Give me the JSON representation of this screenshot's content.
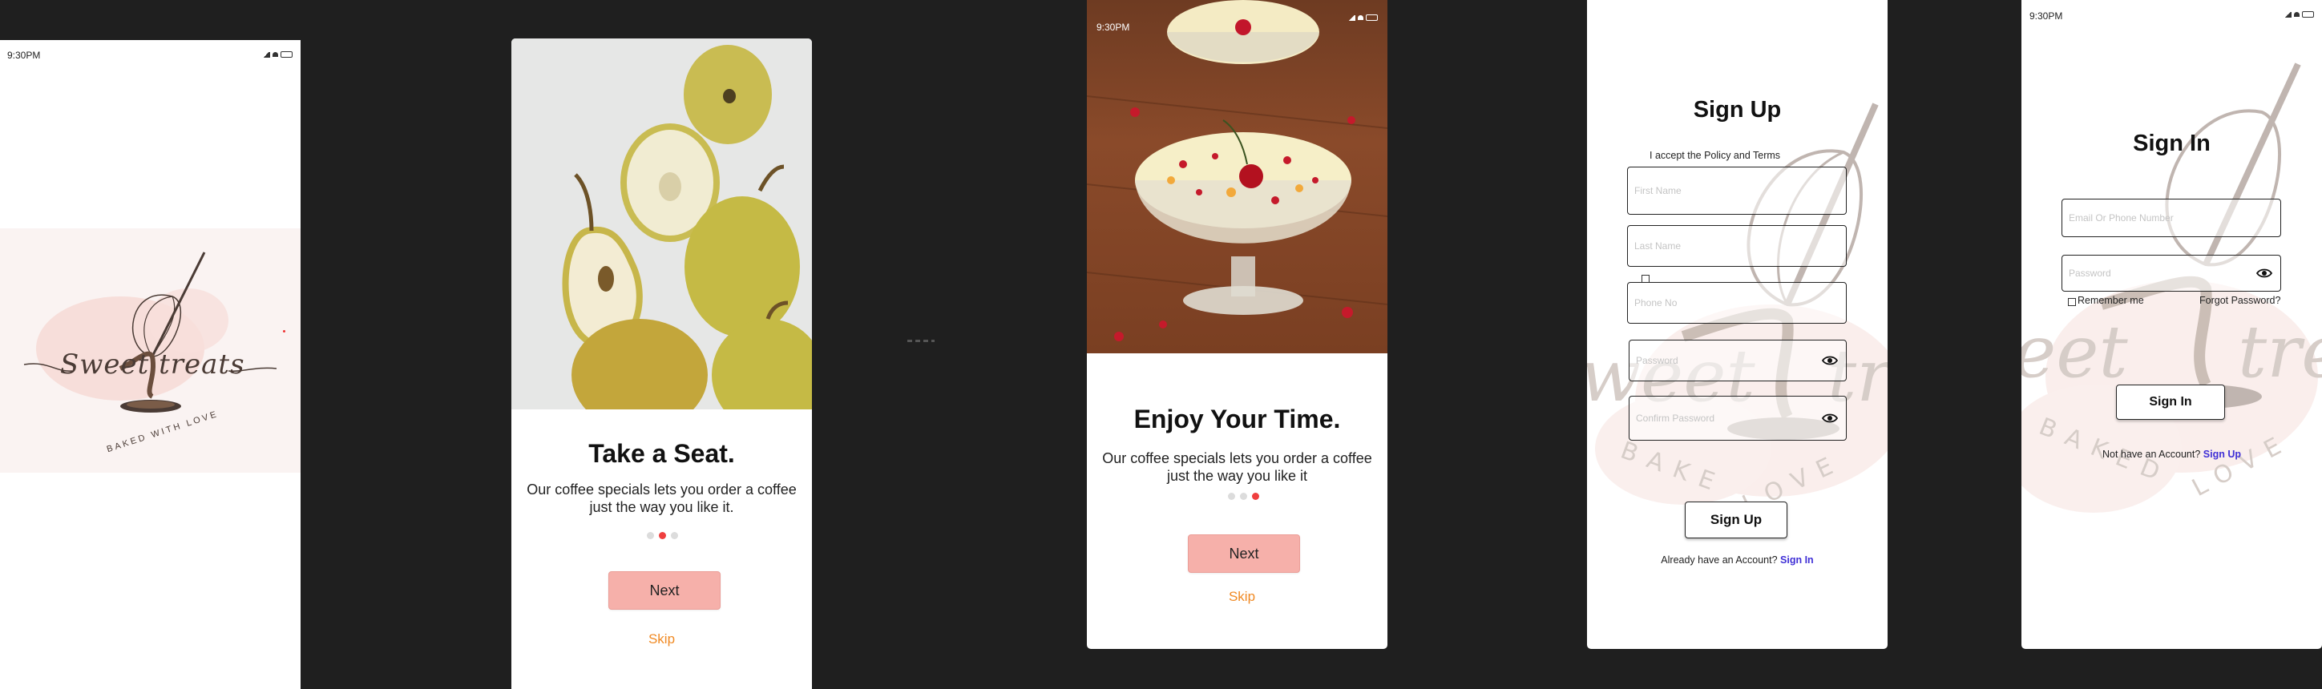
{
  "status_bar": {
    "time": "9:30PM"
  },
  "splash": {
    "logo_script": "Sweet treats",
    "logo_tagline": "BAKED WITH LOVE"
  },
  "onboarding1": {
    "title": "Take a Seat.",
    "description": "Our coffee specials lets you order a coffee just the way you like it.",
    "next_label": "Next",
    "skip_label": "Skip",
    "active_dot": 1
  },
  "onboarding2": {
    "title": "Enjoy Your Time.",
    "description": "Our coffee specials lets you order a coffee just the way you like it",
    "next_label": "Next",
    "skip_label": "Skip",
    "active_dot": 2
  },
  "signup": {
    "title": "Sign Up",
    "policy_label": "I accept the Policy and Terms",
    "first_name_placeholder": "First Name",
    "last_name_placeholder": "Last Name",
    "phone_placeholder": "Phone No",
    "password_placeholder": "Password",
    "confirm_password_placeholder": "Confirm Password",
    "submit_label": "Sign Up",
    "footer_text": "Already have an Account?",
    "footer_link": "Sign In"
  },
  "signin": {
    "title": "Sign In",
    "email_placeholder": "Email Or Phone Number",
    "password_placeholder": "Password",
    "remember_label": "Remember me",
    "forgot_label": "Forgot Password?",
    "submit_label": "Sign In",
    "footer_text": "Not have an Account?",
    "footer_link": "Sign Up"
  },
  "colors": {
    "background": "#1f1f1f",
    "accent_pink": "#f6b0aa",
    "skip_orange": "#f08a24",
    "dot_active": "#ef3f3f",
    "link_blue": "#3f2fd6"
  }
}
